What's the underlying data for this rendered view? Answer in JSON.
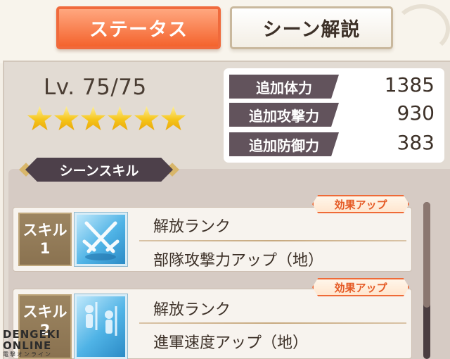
{
  "tabs": [
    {
      "label": "ステータス",
      "active": true
    },
    {
      "label": "シーン解説",
      "active": false
    }
  ],
  "level_text": "Lv. 75/75",
  "stars": {
    "filled": 6,
    "total": 6
  },
  "stats": [
    {
      "label": "追加体力",
      "value": "1385"
    },
    {
      "label": "追加攻撃力",
      "value": "930"
    },
    {
      "label": "追加防御力",
      "value": "383"
    }
  ],
  "scene_skill": {
    "header": "シーンスキル",
    "skills": [
      {
        "tag": "スキル",
        "number": "1",
        "badge": "効果アップ",
        "line1": "解放ランク",
        "line2": "部隊攻撃力アップ（地）",
        "icon": "crossed-swords-icon"
      },
      {
        "tag": "スキル",
        "number": "2",
        "badge": "効果アップ",
        "line1": "解放ランク",
        "line2": "進軍速度アップ（地）",
        "icon": "marching-soldiers-icon"
      }
    ]
  },
  "watermark": {
    "line1": "DENGEKI",
    "line2": "ONLINE",
    "line3": "電撃オンライン"
  },
  "colors": {
    "active_tab": "#f4632d",
    "stat_label_bg": "#62535c",
    "badge_border": "#ef6a37",
    "star": "#f5c417"
  }
}
